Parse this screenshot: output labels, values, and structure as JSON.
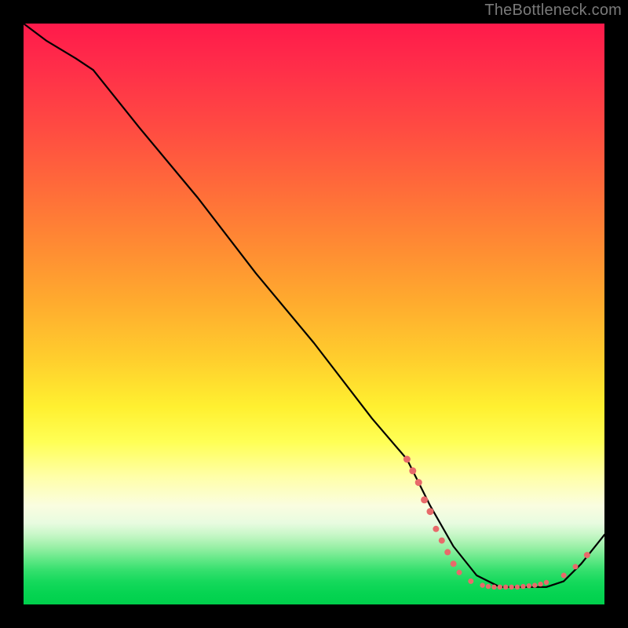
{
  "watermark": "TheBottleneck.com",
  "chart_data": {
    "type": "line",
    "title": "",
    "xlabel": "",
    "ylabel": "",
    "xlim": [
      0,
      100
    ],
    "ylim": [
      0,
      100
    ],
    "grid": false,
    "legend": false,
    "series": [
      {
        "name": "curve",
        "x": [
          0,
          4,
          9,
          12,
          20,
          30,
          40,
          50,
          60,
          66,
          70,
          74,
          78,
          82,
          86,
          90,
          93,
          96,
          100
        ],
        "y": [
          100,
          97,
          94,
          92,
          82,
          70,
          57,
          45,
          32,
          25,
          17,
          10,
          5,
          3,
          3,
          3,
          4,
          7,
          12
        ]
      }
    ],
    "markers": {
      "name": "dots",
      "color": "#e86a6a",
      "points": [
        {
          "x": 66,
          "y": 25,
          "r": 4.5
        },
        {
          "x": 67,
          "y": 23,
          "r": 4.5
        },
        {
          "x": 68,
          "y": 21,
          "r": 4.5
        },
        {
          "x": 69,
          "y": 18,
          "r": 4.5
        },
        {
          "x": 70,
          "y": 16,
          "r": 4.5
        },
        {
          "x": 71,
          "y": 13,
          "r": 4
        },
        {
          "x": 72,
          "y": 11,
          "r": 4
        },
        {
          "x": 73,
          "y": 9,
          "r": 4
        },
        {
          "x": 74,
          "y": 7,
          "r": 4
        },
        {
          "x": 75,
          "y": 5.5,
          "r": 3.5
        },
        {
          "x": 77,
          "y": 4,
          "r": 3.5
        },
        {
          "x": 79,
          "y": 3.3,
          "r": 3.2
        },
        {
          "x": 80,
          "y": 3.1,
          "r": 3.2
        },
        {
          "x": 81,
          "y": 3.0,
          "r": 3.2
        },
        {
          "x": 82,
          "y": 3.0,
          "r": 3.2
        },
        {
          "x": 83,
          "y": 3.0,
          "r": 3.2
        },
        {
          "x": 84,
          "y": 3.0,
          "r": 3.2
        },
        {
          "x": 85,
          "y": 3.0,
          "r": 3.2
        },
        {
          "x": 86,
          "y": 3.1,
          "r": 3.2
        },
        {
          "x": 87,
          "y": 3.2,
          "r": 3.2
        },
        {
          "x": 88,
          "y": 3.3,
          "r": 3.2
        },
        {
          "x": 89,
          "y": 3.5,
          "r": 3.2
        },
        {
          "x": 90,
          "y": 3.8,
          "r": 3.2
        },
        {
          "x": 93,
          "y": 5.0,
          "r": 3.5
        },
        {
          "x": 95,
          "y": 6.5,
          "r": 3.5
        },
        {
          "x": 97,
          "y": 8.5,
          "r": 4
        }
      ]
    },
    "background_gradient": {
      "top": "#ff1a4b",
      "mid_upper": "#ffab2e",
      "mid": "#fff030",
      "mid_lower": "#fafde0",
      "bottom": "#00d04c"
    }
  }
}
